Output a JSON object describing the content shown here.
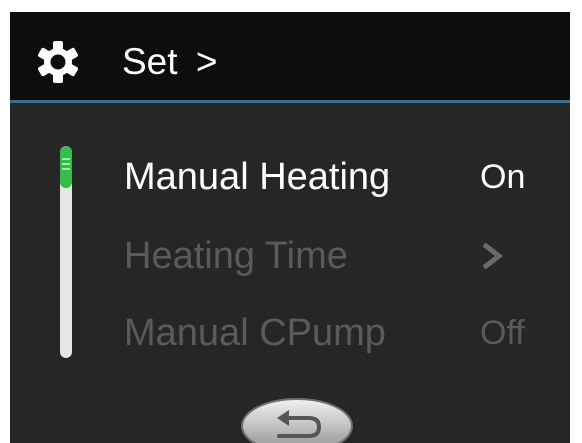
{
  "header": {
    "icon": "gear-icon",
    "title": "Set",
    "title_chevron": ">",
    "accent_line_color": "#3d6f8c"
  },
  "menu": {
    "items": [
      {
        "label": "Manual Heating",
        "value": "On",
        "state": "selected",
        "color": "#ffffff"
      },
      {
        "label": "Heating Time",
        "value": ">",
        "value_icon": "chevron-right-icon",
        "state": "normal",
        "color": "#5a5a5a"
      },
      {
        "label": "Manual CPump",
        "value": "Off",
        "state": "normal",
        "color": "#5a5a5a"
      }
    ]
  },
  "scrollbar": {
    "thumb_color": "#31c045",
    "track_color": "#e6e6e6",
    "position_fraction": 0.0
  },
  "footer": {
    "back_icon": "return-arrow-icon"
  }
}
